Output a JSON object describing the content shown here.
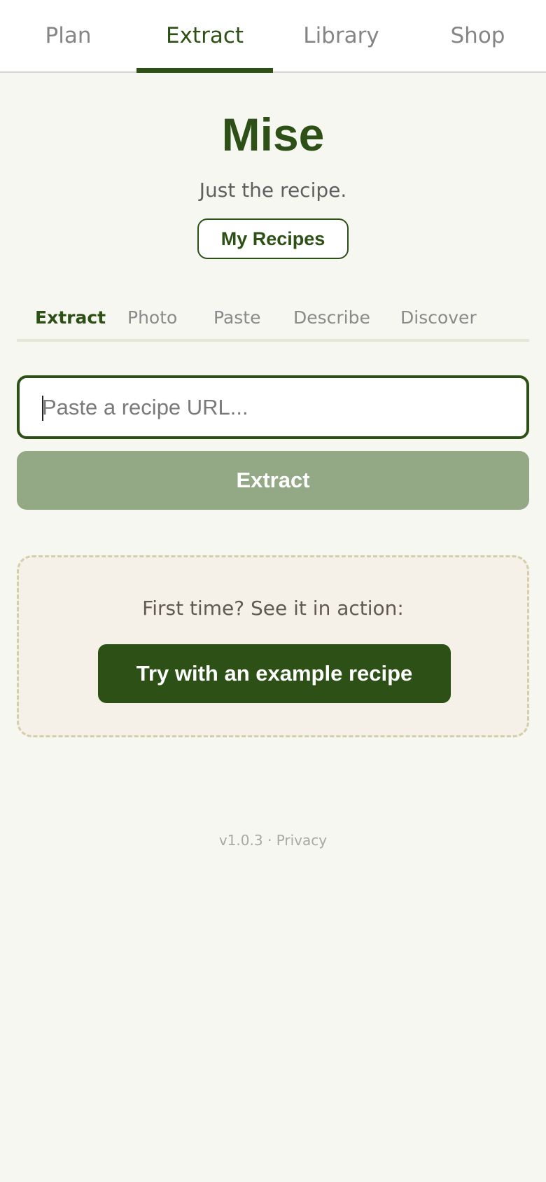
{
  "top_nav": {
    "tabs": [
      {
        "label": "Plan",
        "active": false
      },
      {
        "label": "Extract",
        "active": true
      },
      {
        "label": "Library",
        "active": false
      },
      {
        "label": "Shop",
        "active": false
      }
    ]
  },
  "header": {
    "title": "Mise",
    "tagline": "Just the recipe.",
    "my_recipes_label": "My Recipes"
  },
  "sub_tabs": {
    "items": [
      {
        "label": "Extract",
        "active": true
      },
      {
        "label": "Photo",
        "active": false
      },
      {
        "label": "Paste",
        "active": false
      },
      {
        "label": "Describe",
        "active": false
      },
      {
        "label": "Discover",
        "active": false
      }
    ]
  },
  "extract_form": {
    "url_value": "",
    "url_placeholder": "Paste a recipe URL...",
    "submit_label": "Extract"
  },
  "example": {
    "prompt": "First time? See it in action:",
    "button_label": "Try with an example recipe"
  },
  "footer": {
    "version": "v1.0.3",
    "separator": " · ",
    "privacy_label": "Privacy"
  },
  "colors": {
    "brand": "#2d5016",
    "brand_muted": "#93a884",
    "background": "#f7f7f2",
    "example_background": "#f5f0e8"
  }
}
